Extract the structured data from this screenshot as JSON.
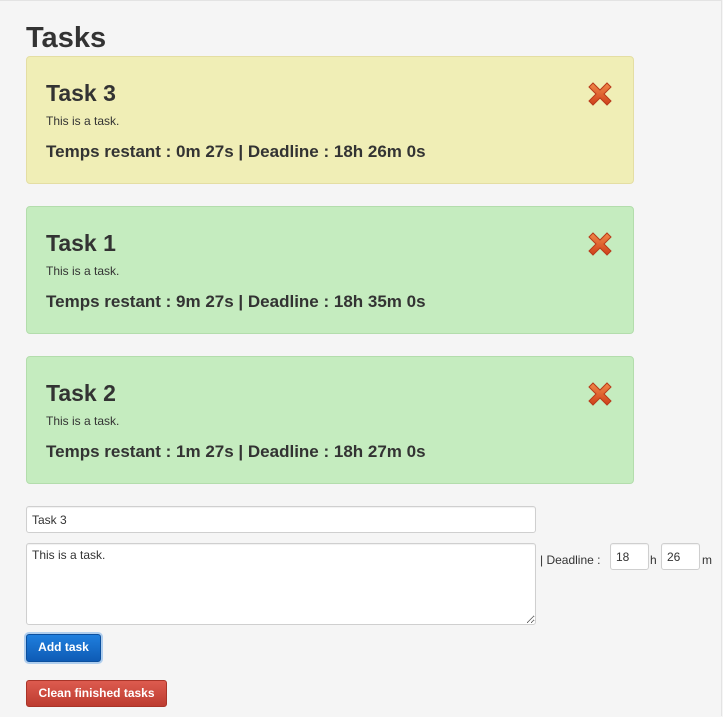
{
  "page": {
    "title": "Tasks"
  },
  "tasks": [
    {
      "title": "Task 3",
      "description": "This is a task.",
      "meta": "Temps restant : 0m 27s | Deadline : 18h 26m 0s",
      "status": "warning",
      "status_color": "#f0eeb6",
      "delete_icon": "close-x-icon"
    },
    {
      "title": "Task 1",
      "description": "This is a task.",
      "meta": "Temps restant : 9m 27s | Deadline : 18h 35m 0s",
      "status": "success",
      "status_color": "#c5ecbf",
      "delete_icon": "close-x-icon"
    },
    {
      "title": "Task 2",
      "description": "This is a task.",
      "meta": "Temps restant : 1m 27s | Deadline : 18h 27m 0s",
      "status": "success",
      "status_color": "#c5ecbf",
      "delete_icon": "close-x-icon"
    }
  ],
  "form": {
    "title_value": "Task 3",
    "description_value": "This is a task.",
    "deadline_label": "| Deadline :",
    "hour_value": "18",
    "hour_unit": "h",
    "minute_value": "26",
    "minute_unit": "m",
    "add_label": "Add task",
    "clean_label": "Clean finished tasks"
  },
  "colors": {
    "primary": "#1f7fde",
    "danger": "#dd5b4f",
    "delete_icon": "#e05a2b"
  }
}
